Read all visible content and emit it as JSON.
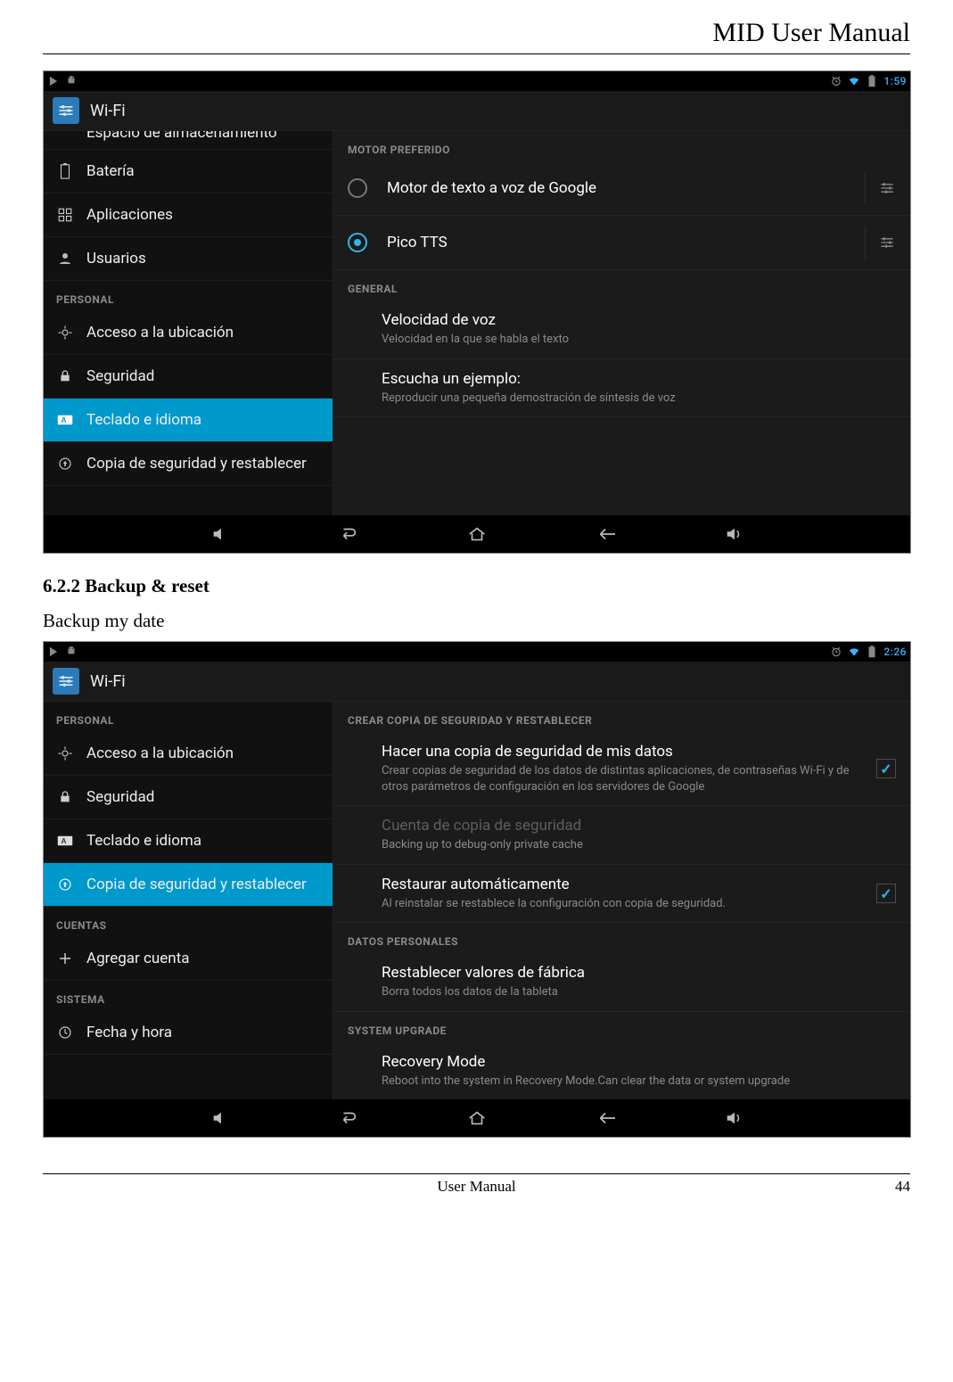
{
  "doc": {
    "header_title": "MID User Manual",
    "section_heading": "6.2.2 Backup & reset",
    "body_text": "Backup my date",
    "footer_center": "User Manual",
    "footer_page": "44"
  },
  "shot1": {
    "clock": "1:59",
    "title": "Wi-Fi",
    "left_nav": {
      "cut_item": "Espacio de almacenamiento",
      "items_top": [
        {
          "label": "Batería",
          "icon": "battery-icon"
        },
        {
          "label": "Aplicaciones",
          "icon": "apps-icon"
        },
        {
          "label": "Usuarios",
          "icon": "users-icon"
        }
      ],
      "heading_personal": "PERSONAL",
      "items_personal": [
        {
          "label": "Acceso a la ubicación",
          "icon": "location-icon"
        },
        {
          "label": "Seguridad",
          "icon": "lock-icon"
        },
        {
          "label": "Teclado e idioma",
          "icon": "keyboard-icon",
          "selected": true
        },
        {
          "label": "Copia de seguridad y restablecer",
          "icon": "backup-icon"
        }
      ]
    },
    "right": {
      "heading_engine": "MOTOR PREFERIDO",
      "engines": [
        {
          "label": "Motor de texto a voz de Google",
          "checked": false
        },
        {
          "label": "Pico TTS",
          "checked": true
        }
      ],
      "heading_general": "GENERAL",
      "general": [
        {
          "title": "Velocidad de voz",
          "sub": "Velocidad en la que se habla el texto"
        },
        {
          "title": "Escucha un ejemplo:",
          "sub": "Reproducir una pequeña demostración de síntesis de voz"
        }
      ]
    }
  },
  "shot2": {
    "clock": "2:26",
    "title": "Wi-Fi",
    "left_nav": {
      "heading_personal": "PERSONAL",
      "items_personal": [
        {
          "label": "Acceso a la ubicación",
          "icon": "location-icon"
        },
        {
          "label": "Seguridad",
          "icon": "lock-icon"
        },
        {
          "label": "Teclado e idioma",
          "icon": "keyboard-icon"
        },
        {
          "label": "Copia de seguridad y restablecer",
          "icon": "backup-icon",
          "selected": true
        }
      ],
      "heading_accounts": "CUENTAS",
      "items_accounts": [
        {
          "label": "Agregar cuenta",
          "icon": "plus-icon"
        }
      ],
      "heading_system": "SISTEMA",
      "items_system": [
        {
          "label": "Fecha y hora",
          "icon": "clock-icon"
        }
      ]
    },
    "right": {
      "heading_backup": "CREAR COPIA DE SEGURIDAD Y RESTABLECER",
      "rows_backup": [
        {
          "title": "Hacer una copia de seguridad de mis datos",
          "sub": "Crear copias de seguridad de los datos de distintas aplicaciones, de contraseñas Wi-Fi y de otros parámetros de configuración en los servidores de Google",
          "check": true
        },
        {
          "title": "Cuenta de copia de seguridad",
          "sub": "Backing up to debug-only private cache",
          "disabled": true
        },
        {
          "title": "Restaurar automáticamente",
          "sub": "Al reinstalar se restablece la configuración con copia de seguridad.",
          "check": true
        }
      ],
      "heading_personal_data": "DATOS PERSONALES",
      "rows_personal": [
        {
          "title": "Restablecer valores de fábrica",
          "sub": "Borra todos los datos de la tableta"
        }
      ],
      "heading_upgrade": "SYSTEM UPGRADE",
      "rows_upgrade": [
        {
          "title": "Recovery Mode",
          "sub": "Reboot into the system in Recovery Mode.Can clear the data or system upgrade"
        }
      ]
    }
  }
}
